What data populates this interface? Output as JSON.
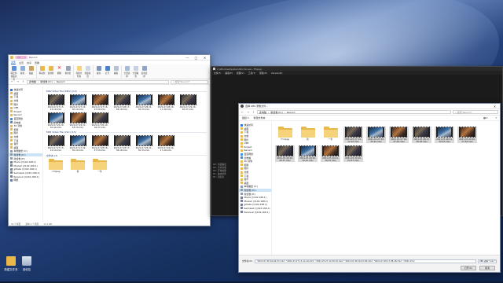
{
  "desktop": {
    "icons": [
      {
        "label": "新建文件夹",
        "icon": "folder-icon"
      },
      {
        "label": "回收站",
        "icon": "recycle-bin-icon"
      }
    ]
  },
  "explorer": {
    "title": "Record",
    "ribbon_tabs": [
      "文件",
      "主页",
      "共享",
      "查看",
      "视频工具"
    ],
    "ribbon_buttons": [
      "固定到快速访问",
      "复制",
      "粘贴",
      "移动到",
      "复制到",
      "删除",
      "重命名",
      "新建文件夹",
      "新建项目",
      "属性",
      "打开",
      "编辑",
      "全部选择",
      "全部取消",
      "反向选择"
    ],
    "breadcrumb": [
      "此电脑",
      "新加卷 (D:)",
      "Record"
    ],
    "search_placeholder": "搜索\"Record\"",
    "nav": [
      "快速访问",
      "桌面",
      "下载",
      "文档",
      "图片",
      "OPE",
      "Project",
      "Record",
      "百度网盘",
      "此电脑",
      "3D 对象",
      "视频",
      "图片",
      "文档",
      "下载",
      "音乐",
      "桌面",
      "本地磁盘 (C:)",
      "新加卷 (D:)",
      "新加卷 (E:)",
      "Movie (\\\\192.168.1)",
      "Movie2 (\\\\192.168.1)",
      "gitlabs (\\\\192.168.1)",
      "Semiweb (\\\\192.168.1)",
      "Personal (\\\\192.168.1)",
      "网络"
    ],
    "selected_nav": "新加卷 (D:)",
    "groups": [
      {
        "header": "MKV Video File (MKV) (13)",
        "files": [
          "2021-07-27 13-12-10.mkv",
          "2021-07-27 22-30-10.mkv",
          "2021-07-27 16-47-00.mkv",
          "2021-07-28 17-38-18.mkv",
          "2021-07-28 21-30-33.mkv",
          "2021-07-28 20-17-49.mkv",
          "2021-07-29 20-20-37.mkv",
          "2021-07-29 20-10-42.mkv",
          "2021-07-29 21-18-15.mkv",
          "2021-07-30 20-04-37.mkv"
        ]
      },
      {
        "header": "MP4 Video File (VLC) (15)",
        "files": [
          "2021-07-27 13-12-10.mkv",
          "2021-07-27 22-30-10.mkv",
          "2021-07-28 16-47-50.mkv",
          "2021-07-28 17-38-18.mkv",
          "2021-07-28 21-30-33.mkv",
          "2021-07-29 20-17-49.mkv"
        ]
      },
      {
        "header": "文件夹 (3)",
        "files": [
          "!!!mpeg",
          "新",
          "一条"
        ]
      }
    ],
    "status": [
      "31 个项目",
      "选中 1 个项目",
      "17.1 GB"
    ]
  },
  "terminal": {
    "title": "C:\\Windows\\System32\\cmd.exe - ffmpeg",
    "menu": [
      "文件(F)",
      "编辑(E)",
      "视图(V)",
      "工具(T)",
      "帮助(H)",
      "Version(B)"
    ],
    "side_lines": [
      "00 : 创建输出",
      "00 : 合并完成",
      "00 : 开始处理",
      "01 : 输出文件",
      "01 : 流信息"
    ]
  },
  "dialog": {
    "title": "选择 OBS 录像文件...",
    "breadcrumb": [
      "此电脑",
      "新加卷 (D:)",
      "Record"
    ],
    "search_placeholder": "搜索\"Record\"",
    "toolbar": [
      "组织 ▾",
      "新建文件夹"
    ],
    "nav": [
      "快速访问",
      "桌面",
      "下载",
      "文档",
      "图片",
      "OPE",
      "Project",
      "Record",
      "百度网盘",
      "此电脑",
      "3D 对象",
      "视频",
      "图片",
      "文档",
      "下载",
      "音乐",
      "桌面",
      "本地磁盘 (C:)",
      "新加卷 (D:)",
      "新加卷 (E:)",
      "Movie (\\\\192.168.1)",
      "Movie2 (\\\\192.168.1)",
      "gitlabs (\\\\192.168.1)",
      "Semiweb (\\\\192.168.1)",
      "Personal (\\\\192.168.1)"
    ],
    "selected_nav": "新加卷 (D:)",
    "files": [
      "!!!mpeg",
      "新",
      "一条",
      "2021-07-27 13-12-10.mkv",
      "2021-07-27 22-30-10.mkv",
      "2021-07-27 16-47-00.mkv",
      "2021-07-28 17-38-18.mkv",
      "2021-07-28 21-30-33.mkv",
      "2021-07-29 20-17-49.mkv",
      "2021-07-29 20-20-37.mkv",
      "2021-07-29 20-10-42.mkv",
      "2021-07-29 21-18-15.mkv",
      "2021-07-30 20-04-37.mkv"
    ],
    "filename_label": "文件名(N):",
    "filename_value": "\"2021-07-30 20-04-37.mkv\" \"2021-07-27 13-12-10.mkv\" \"2021-07-27 22-30-10.mkv\" \"2021-07-28 16-47-00.mkv\" \"2021-07-28 17-38-18.mkv\" \"2021-07-2",
    "filetype": "OBS 录像(*.mkv *.mp4 *.flv *.ts)",
    "open_label": "打开(O)",
    "cancel_label": "取消"
  }
}
